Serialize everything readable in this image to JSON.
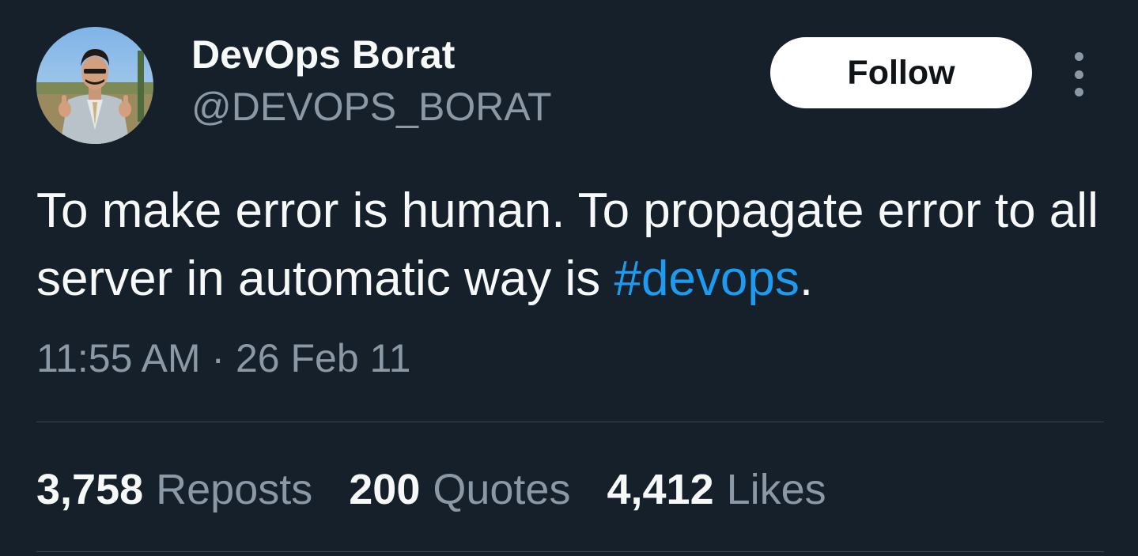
{
  "author": {
    "display_name": "DevOps Borat",
    "handle": "@DEVOPS_BORAT"
  },
  "actions": {
    "follow_label": "Follow",
    "more_icon": "more-vertical-icon"
  },
  "tweet": {
    "text_before": "To make error is human. To propagate error to all server in automatic way is ",
    "hashtag": "#devops",
    "text_after": ".",
    "timestamp": "11:55 AM · 26 Feb 11"
  },
  "stats": [
    {
      "count": "3,758",
      "label": "Reposts"
    },
    {
      "count": "200",
      "label": "Quotes"
    },
    {
      "count": "4,412",
      "label": "Likes"
    }
  ],
  "colors": {
    "background": "#15202b",
    "primary_text": "#f7f9f9",
    "secondary_text": "#8b98a5",
    "link": "#1d9bf0",
    "divider": "#38444d",
    "button_bg": "#ffffff"
  }
}
